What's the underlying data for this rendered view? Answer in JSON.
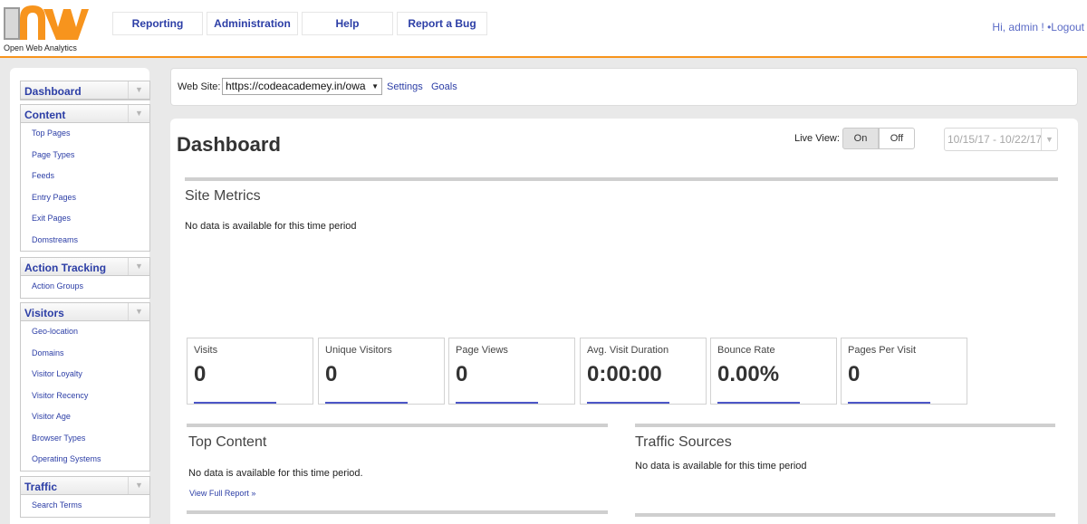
{
  "header": {
    "logo_text": "Open Web Analytics",
    "nav": [
      "Reporting",
      "Administration",
      "Help",
      "Report a Bug"
    ],
    "greeting": "Hi, admin ! ",
    "separator": "•",
    "logout": "Logout"
  },
  "colors": {
    "accent": "#f7941d",
    "link": "#2c3ea6",
    "spark": "#4c56c7"
  },
  "sidebar": {
    "groups": [
      {
        "title": "Dashboard",
        "items": []
      },
      {
        "title": "Content",
        "items": [
          "Top Pages",
          "Page Types",
          "Feeds",
          "Entry Pages",
          "Exit Pages",
          "Domstreams"
        ]
      },
      {
        "title": "Action Tracking",
        "items": [
          "Action Groups"
        ]
      },
      {
        "title": "Visitors",
        "items": [
          "Geo-location",
          "Domains",
          "Visitor Loyalty",
          "Visitor Recency",
          "Visitor Age",
          "Browser Types",
          "Operating Systems"
        ]
      },
      {
        "title": "Traffic",
        "items": [
          "Search Terms"
        ]
      }
    ]
  },
  "site_bar": {
    "label": "Web Site:",
    "selected": "https://codeacademey.in/owa",
    "settings": "Settings",
    "goals": "Goals"
  },
  "main": {
    "title": "Dashboard",
    "live_view_label": "Live View:",
    "live_on": "On",
    "live_off": "Off",
    "date_range": "10/15/17 - 10/22/17",
    "site_metrics": {
      "title": "Site Metrics",
      "no_data": "No data is available for this time period"
    },
    "metrics": [
      {
        "label": "Visits",
        "value": "0"
      },
      {
        "label": "Unique Visitors",
        "value": "0"
      },
      {
        "label": "Page Views",
        "value": "0"
      },
      {
        "label": "Avg. Visit Duration",
        "value": "0:00:00"
      },
      {
        "label": "Bounce Rate",
        "value": "0.00%"
      },
      {
        "label": "Pages Per Visit",
        "value": "0"
      }
    ],
    "top_content": {
      "title": "Top Content",
      "no_data": "No data is available for this time period.",
      "link": "View Full Report »"
    },
    "traffic_sources": {
      "title": "Traffic Sources",
      "no_data": "No data is available for this time period"
    }
  }
}
